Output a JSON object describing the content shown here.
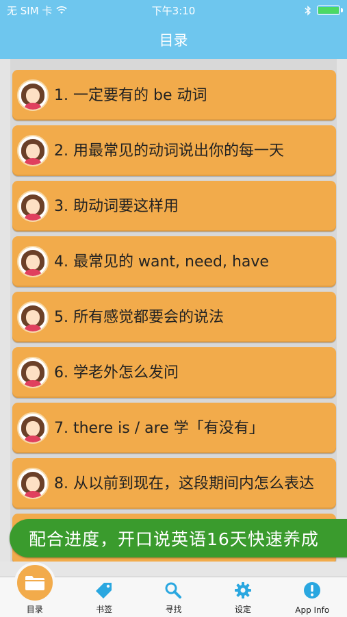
{
  "status": {
    "carrier": "无 SIM 卡",
    "time": "下午3:10"
  },
  "nav": {
    "title": "目录"
  },
  "lessons": [
    {
      "label": "1. 一定要有的 be 动词"
    },
    {
      "label": "2. 用最常见的动词说出你的每一天"
    },
    {
      "label": "3. 助动词要这样用"
    },
    {
      "label": "4. 最常见的 want, need, have"
    },
    {
      "label": "5. 所有感觉都要会的说法"
    },
    {
      "label": "6. 学老外怎么发问"
    },
    {
      "label": "7. there is / are 学「有没有」"
    },
    {
      "label": "8. 从以前到现在，这段期间内怎么表达"
    }
  ],
  "banner": {
    "text": "配合进度，开口说英语16天快速养成"
  },
  "tabs": [
    {
      "label": "目录",
      "icon": "folder-icon",
      "active": true
    },
    {
      "label": "书签",
      "icon": "tag-icon"
    },
    {
      "label": "寻找",
      "icon": "search-icon"
    },
    {
      "label": "设定",
      "icon": "gear-icon"
    },
    {
      "label": "App Info",
      "icon": "info-icon"
    }
  ],
  "colors": {
    "nav": "#6ec6ee",
    "card": "#f2ab4b",
    "banner": "#3a9b2d",
    "tab_icon": "#2aa7e0"
  }
}
